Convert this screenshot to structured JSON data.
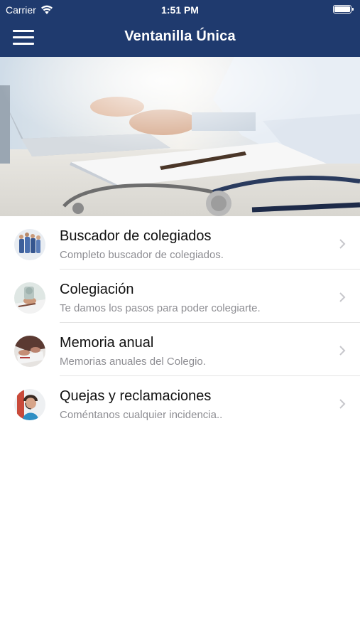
{
  "status_bar": {
    "carrier": "Carrier",
    "time": "1:51 PM"
  },
  "nav": {
    "title": "Ventanilla Única",
    "menu_icon": "hamburger-menu-icon"
  },
  "colors": {
    "nav_background": "#1f3a6e",
    "subtitle": "#8e8e93",
    "separator": "#e4e4e4"
  },
  "hero": {
    "subject": "doctor typing on laptop with stethoscope and clipboard"
  },
  "menu": [
    {
      "title": "Buscador de colegiados",
      "subtitle": "Completo buscador de colegiados.",
      "thumb": "medical-team"
    },
    {
      "title": "Colegiación",
      "subtitle": "Te damos los pasos para poder colegiarte.",
      "thumb": "doctor-writing"
    },
    {
      "title": "Memoria anual",
      "subtitle": "Memorias anuales del Colegio.",
      "thumb": "hands-paperwork"
    },
    {
      "title": "Quejas y reclamaciones",
      "subtitle": "Coméntanos cualquier incidencia..",
      "thumb": "nurse-headset"
    }
  ]
}
